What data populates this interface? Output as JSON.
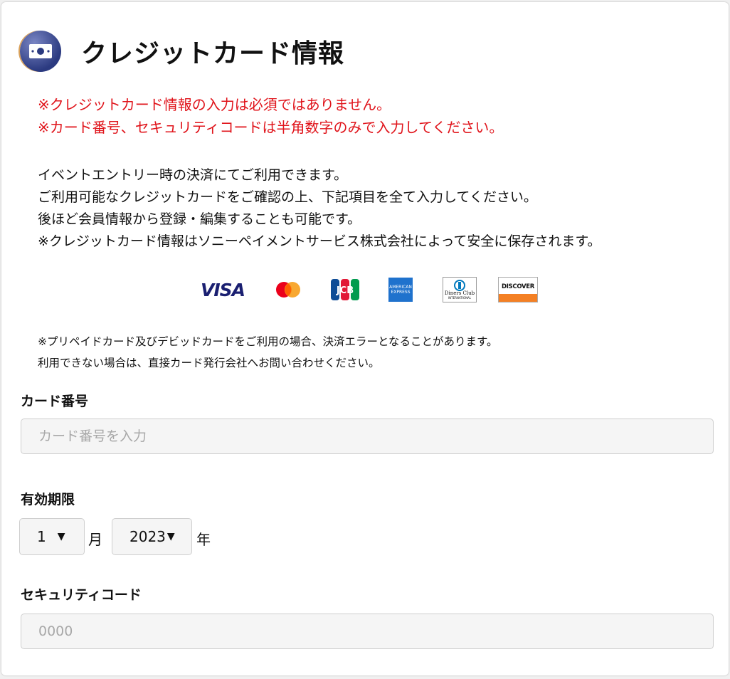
{
  "header": {
    "title": "クレジットカード情報",
    "icon": "money-icon"
  },
  "notice": {
    "color": "#e0141b",
    "lines": [
      "※クレジットカード情報の入力は必須ではありません。",
      "※カード番号、セキュリティコードは半角数字のみで入力してください。"
    ]
  },
  "description": {
    "lines": [
      "イベントエントリー時の決済にてご利用できます。",
      "ご利用可能なクレジットカードをご確認の上、下記項目を全て入力してください。",
      "後ほど会員情報から登録・編集することも可能です。",
      "※クレジットカード情報はソニーペイメントサービス株式会社によって安全に保存されます。"
    ]
  },
  "brands": {
    "visa": "VISA",
    "jcb": "JCB",
    "amex_line1": "AMERICAN",
    "amex_line2": "EXPRESS",
    "diners_line1": "Diners Club",
    "diners_line2": "INTERNATIONAL",
    "discover": "DISCOVER"
  },
  "note": {
    "lines": [
      "※プリペイドカード及びデビッドカードをご利用の場合、決済エラーとなることがあります。",
      "利用できない場合は、直接カード発行会社へお問い合わせください。"
    ]
  },
  "card_number": {
    "label": "カード番号",
    "placeholder": "カード番号を入力",
    "value": ""
  },
  "expiry": {
    "label": "有効期限",
    "month_value": "1",
    "month_unit": "月",
    "year_value": "2023",
    "year_unit": "年"
  },
  "security_code": {
    "label": "セキュリティコード",
    "placeholder": "0000",
    "value": ""
  }
}
